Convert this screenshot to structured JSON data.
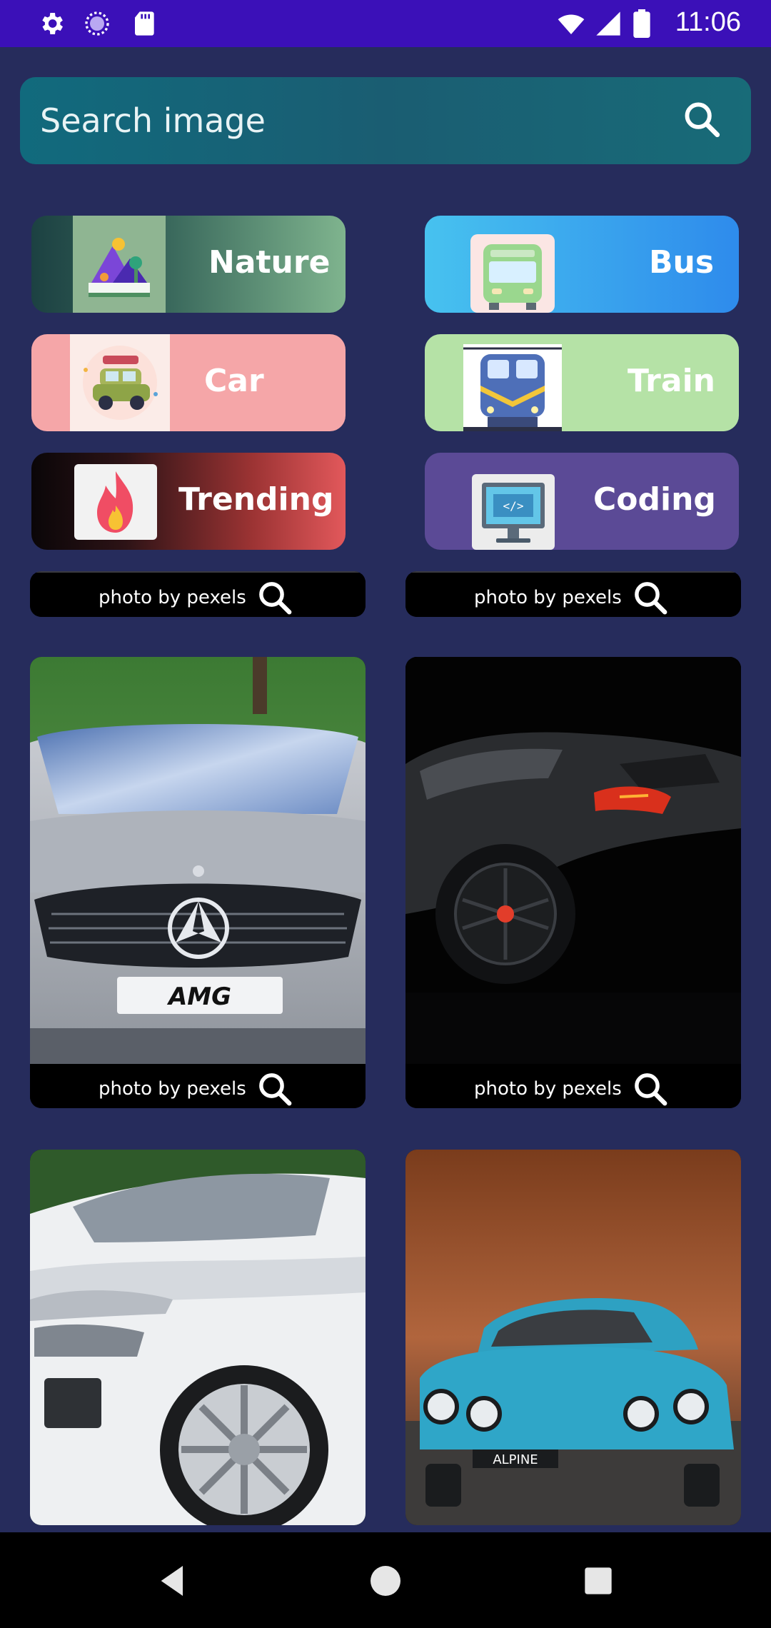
{
  "status_bar": {
    "time": "11:06",
    "left_icons": [
      "gear-icon",
      "loading-icon",
      "sd-card-icon"
    ],
    "right_icons": [
      "wifi-icon",
      "signal-icon",
      "battery-icon"
    ]
  },
  "search": {
    "placeholder": "Search image",
    "icon": "search-icon"
  },
  "categories": [
    {
      "label": "Nature",
      "icon": "nature-icon"
    },
    {
      "label": "Bus",
      "icon": "bus-icon"
    },
    {
      "label": "Car",
      "icon": "car-icon"
    },
    {
      "label": "Train",
      "icon": "train-icon"
    },
    {
      "label": "Trending",
      "icon": "fire-icon"
    },
    {
      "label": "Coding",
      "icon": "monitor-code-icon"
    }
  ],
  "photos": [
    {
      "caption": "photo by pexels",
      "subject": "car"
    },
    {
      "caption": "photo by pexels",
      "subject": "car"
    },
    {
      "caption": "photo by pexels",
      "subject": "silver mercedes amg car"
    },
    {
      "caption": "photo by pexels",
      "subject": "black sports car"
    },
    {
      "caption": "",
      "subject": "white suv"
    },
    {
      "caption": "",
      "subject": "blue alpine car"
    }
  ],
  "plate_text": {
    "amg": "AMG",
    "alpine": "ALPINE"
  },
  "nav_bar": {
    "buttons": [
      "back-icon",
      "home-icon",
      "recents-icon"
    ]
  },
  "colors": {
    "status_bar": "#3b10b8",
    "background": "#262c5c",
    "search_bar": "#116a7d"
  }
}
